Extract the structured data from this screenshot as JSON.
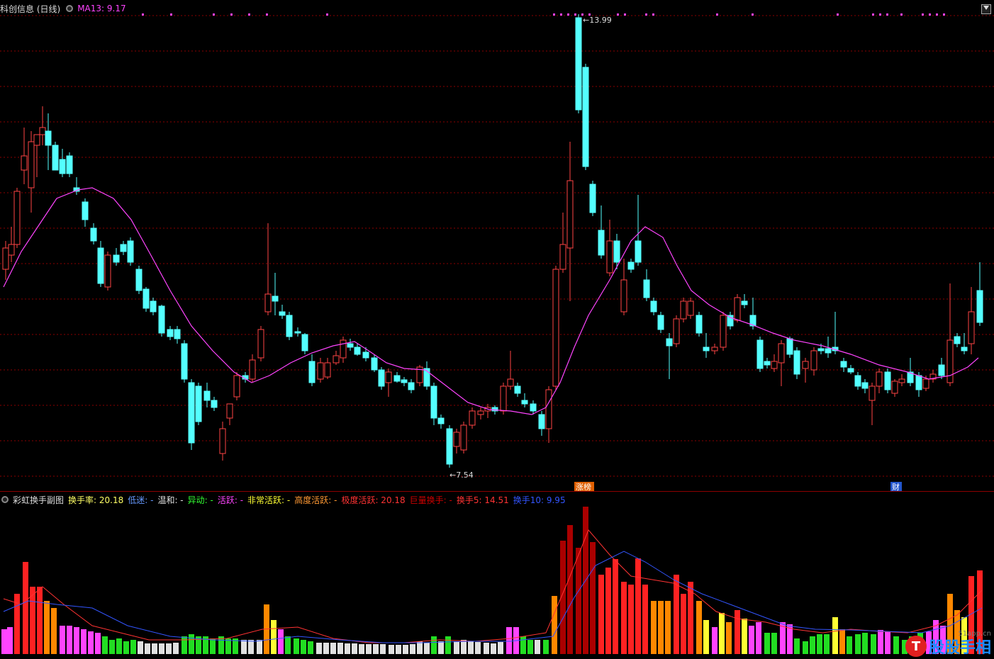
{
  "main": {
    "title": "科创信息 (日线)",
    "ma_label": "MA13: 9.17",
    "high_label": "13.99",
    "low_label": "7.54",
    "tags": [
      "涨榜",
      "财"
    ],
    "colors": {
      "up": "#ff4444",
      "down": "#54ffff",
      "ma": "#ff44ff",
      "grid": "#8b0000"
    }
  },
  "sub": {
    "title": "彩虹换手副图",
    "legend": [
      {
        "text": "换手率: 20.18",
        "color": "#ffff66"
      },
      {
        "text": "低迷: -",
        "color": "#6699ff"
      },
      {
        "text": "温和: -",
        "color": "#e0e0e0"
      },
      {
        "text": "异动: -",
        "color": "#33ff33"
      },
      {
        "text": "活跃: -",
        "color": "#ff44ff"
      },
      {
        "text": "非常活跃: -",
        "color": "#ffff33"
      },
      {
        "text": "高度活跃: -",
        "color": "#ff9933"
      },
      {
        "text": "极度活跃: 20.18",
        "color": "#ff3333"
      },
      {
        "text": "巨量换手: -",
        "color": "#cc0000"
      },
      {
        "text": "换手5: 14.51",
        "color": "#ff3333"
      },
      {
        "text": "换手10: 9.95",
        "color": "#3355ff"
      }
    ],
    "colors": {
      "low": "#e0e0e0",
      "mild": "#e0e0e0",
      "abnormal": "#22dd22",
      "active": "#ff44ff",
      "very_active": "#ffff33",
      "high": "#ff8800",
      "extreme": "#ff2222",
      "huge": "#aa0000"
    }
  },
  "watermark": {
    "logo": "T",
    "text": "股股手相",
    "domain": "51app.cn"
  }
}
